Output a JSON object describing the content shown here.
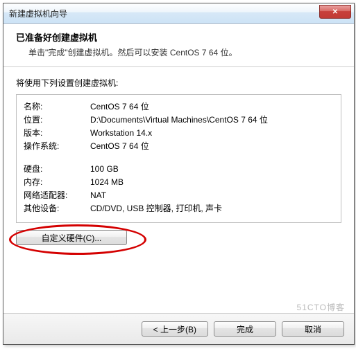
{
  "titlebar": {
    "title": "新建虚拟机向导",
    "close": "✕"
  },
  "header": {
    "heading": "已准备好创建虚拟机",
    "subtitle": "单击\"完成\"创建虚拟机。然后可以安装 CentOS 7 64 位。"
  },
  "lead": "将使用下列设置创建虚拟机:",
  "settings": {
    "name_label": "名称:",
    "name_value": "CentOS 7 64 位",
    "location_label": "位置:",
    "location_value": "D:\\Documents\\Virtual Machines\\CentOS 7 64 位",
    "version_label": "版本:",
    "version_value": "Workstation 14.x",
    "os_label": "操作系统:",
    "os_value": "CentOS 7 64 位",
    "disk_label": "硬盘:",
    "disk_value": "100 GB",
    "memory_label": "内存:",
    "memory_value": "1024 MB",
    "network_label": "网络适配器:",
    "network_value": "NAT",
    "other_label": "其他设备:",
    "other_value": "CD/DVD, USB 控制器, 打印机, 声卡"
  },
  "buttons": {
    "customize": "自定义硬件(C)...",
    "back": "< 上一步(B)",
    "finish": "完成",
    "cancel": "取消"
  },
  "watermark": "51CTO博客"
}
